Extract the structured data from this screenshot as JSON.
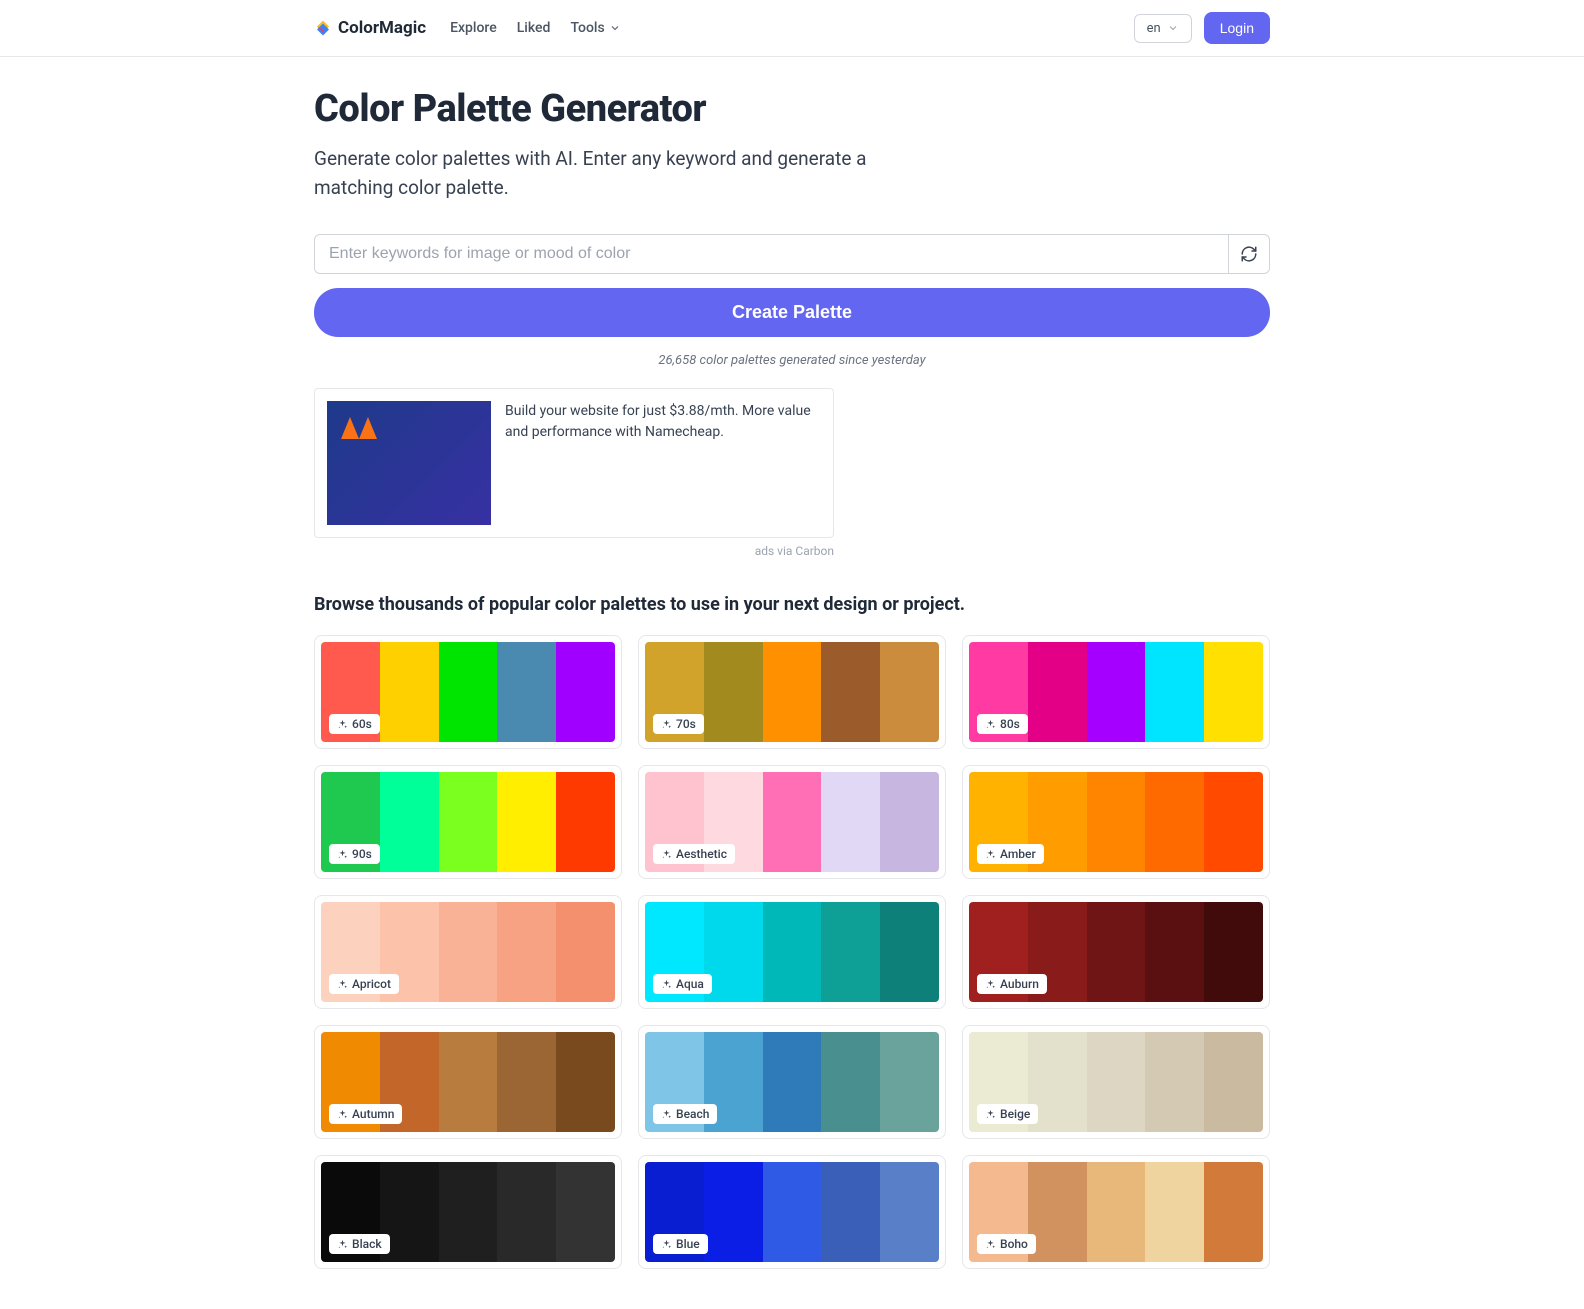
{
  "brand": "ColorMagic",
  "nav": {
    "explore": "Explore",
    "liked": "Liked",
    "tools": "Tools"
  },
  "header": {
    "lang": "en",
    "login": "Login"
  },
  "hero": {
    "title": "Color Palette Generator",
    "subtitle": "Generate color palettes with AI. Enter any keyword and generate a matching color palette.",
    "placeholder": "Enter keywords for image or mood of color",
    "create": "Create Palette",
    "stats": "26,658 color palettes generated since yesterday"
  },
  "ad": {
    "text": "Build your website for just $3.88/mth. More value and performance with Namecheap.",
    "via": "ads via Carbon"
  },
  "browse": {
    "heading": "Browse thousands of popular color palettes to use in your next design or project."
  },
  "palettes": [
    {
      "name": "60s",
      "colors": [
        "#ff5a4d",
        "#ffd000",
        "#00e500",
        "#4a8ab0",
        "#a000ff"
      ]
    },
    {
      "name": "70s",
      "colors": [
        "#d1a32b",
        "#a38a1f",
        "#ff9000",
        "#9c5b2b",
        "#cc8c3d"
      ]
    },
    {
      "name": "80s",
      "colors": [
        "#ff3aa3",
        "#e30087",
        "#a500ff",
        "#00e5ff",
        "#ffe000"
      ]
    },
    {
      "name": "90s",
      "colors": [
        "#1fc94f",
        "#00ff99",
        "#7aff1f",
        "#ffee00",
        "#ff3a00"
      ]
    },
    {
      "name": "Aesthetic",
      "colors": [
        "#ffc3d0",
        "#ffd9e0",
        "#ff6fb5",
        "#e0d8f5",
        "#c6b6e0"
      ]
    },
    {
      "name": "Amber",
      "colors": [
        "#ffb300",
        "#ff9d00",
        "#ff8500",
        "#ff6a00",
        "#ff4a00"
      ]
    },
    {
      "name": "Apricot",
      "colors": [
        "#fcd1bd",
        "#fcc2aa",
        "#fab297",
        "#f7a283",
        "#f5906e"
      ]
    },
    {
      "name": "Aqua",
      "colors": [
        "#00e8ff",
        "#00d8eb",
        "#00b8b8",
        "#0e9f96",
        "#0c8079"
      ]
    },
    {
      "name": "Auburn",
      "colors": [
        "#a02020",
        "#8a1b1b",
        "#6f1515",
        "#5a1010",
        "#420b0b"
      ]
    },
    {
      "name": "Autumn",
      "colors": [
        "#f08a00",
        "#c26729",
        "#b87c3e",
        "#9c6534",
        "#7a4a1f"
      ]
    },
    {
      "name": "Beach",
      "colors": [
        "#7ec5e8",
        "#4aa3d1",
        "#2f7ab8",
        "#4a8f8f",
        "#6aa39c"
      ]
    },
    {
      "name": "Beige",
      "colors": [
        "#ebead3",
        "#e3e0cc",
        "#ddd6c2",
        "#d4c9b2",
        "#c9baa0"
      ]
    },
    {
      "name": "Black",
      "colors": [
        "#0a0a0a",
        "#151515",
        "#1f1f1f",
        "#292929",
        "#333333"
      ]
    },
    {
      "name": "Blue",
      "colors": [
        "#0a1ed1",
        "#0a1ee5",
        "#2f5ae5",
        "#3a5fb8",
        "#5a7fc9"
      ]
    },
    {
      "name": "Boho",
      "colors": [
        "#f5b98f",
        "#d19260",
        "#e8b87a",
        "#f0d4a0",
        "#d17a3a"
      ]
    }
  ]
}
